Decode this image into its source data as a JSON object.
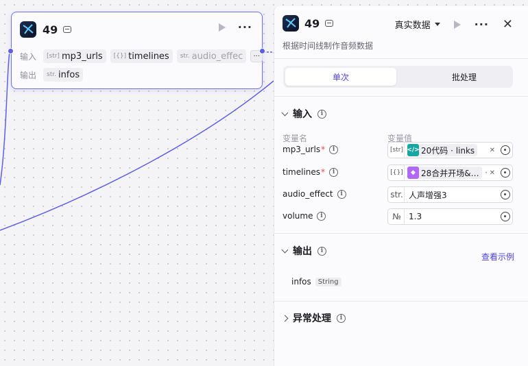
{
  "node": {
    "title": "49",
    "input_label": "输入",
    "output_label": "输出",
    "inputs": [
      {
        "type": "[str]",
        "name": "mp3_urls"
      },
      {
        "type": "[{}]",
        "name": "timelines"
      },
      {
        "type": "str.",
        "name": "audio_effec"
      }
    ],
    "more": "···",
    "outputs": [
      {
        "type": "str.",
        "name": "infos"
      }
    ]
  },
  "panel": {
    "title": "49",
    "mode": "真实数据",
    "description": "根据时间线制作音频数据",
    "tabs": [
      {
        "label": "单次",
        "active": true
      },
      {
        "label": "批处理",
        "active": false
      }
    ],
    "input_section": "输入",
    "col_name": "变量名",
    "col_value": "变量值",
    "params": [
      {
        "name": "mp3_urls",
        "required": true,
        "type": "[str]",
        "ref_icon": "code",
        "ref": "20代码 · links"
      },
      {
        "name": "timelines",
        "required": true,
        "type": "[{}]",
        "ref_icon": "cube",
        "ref": "28合并开场&…"
      },
      {
        "name": "audio_effect",
        "required": false,
        "type": "str.",
        "value": "人声增强3"
      },
      {
        "name": "volume",
        "required": false,
        "type": "№",
        "value": "1.3"
      }
    ],
    "output_section": "输出",
    "view_example": "查看示例",
    "output_item": {
      "name": "infos",
      "type": "String"
    },
    "error_section": "异常处理"
  },
  "colors": {
    "accent": "#4e40e5",
    "edge": "#5b5ee8",
    "teal": "#16a7a2",
    "purple": "#b169f5"
  }
}
